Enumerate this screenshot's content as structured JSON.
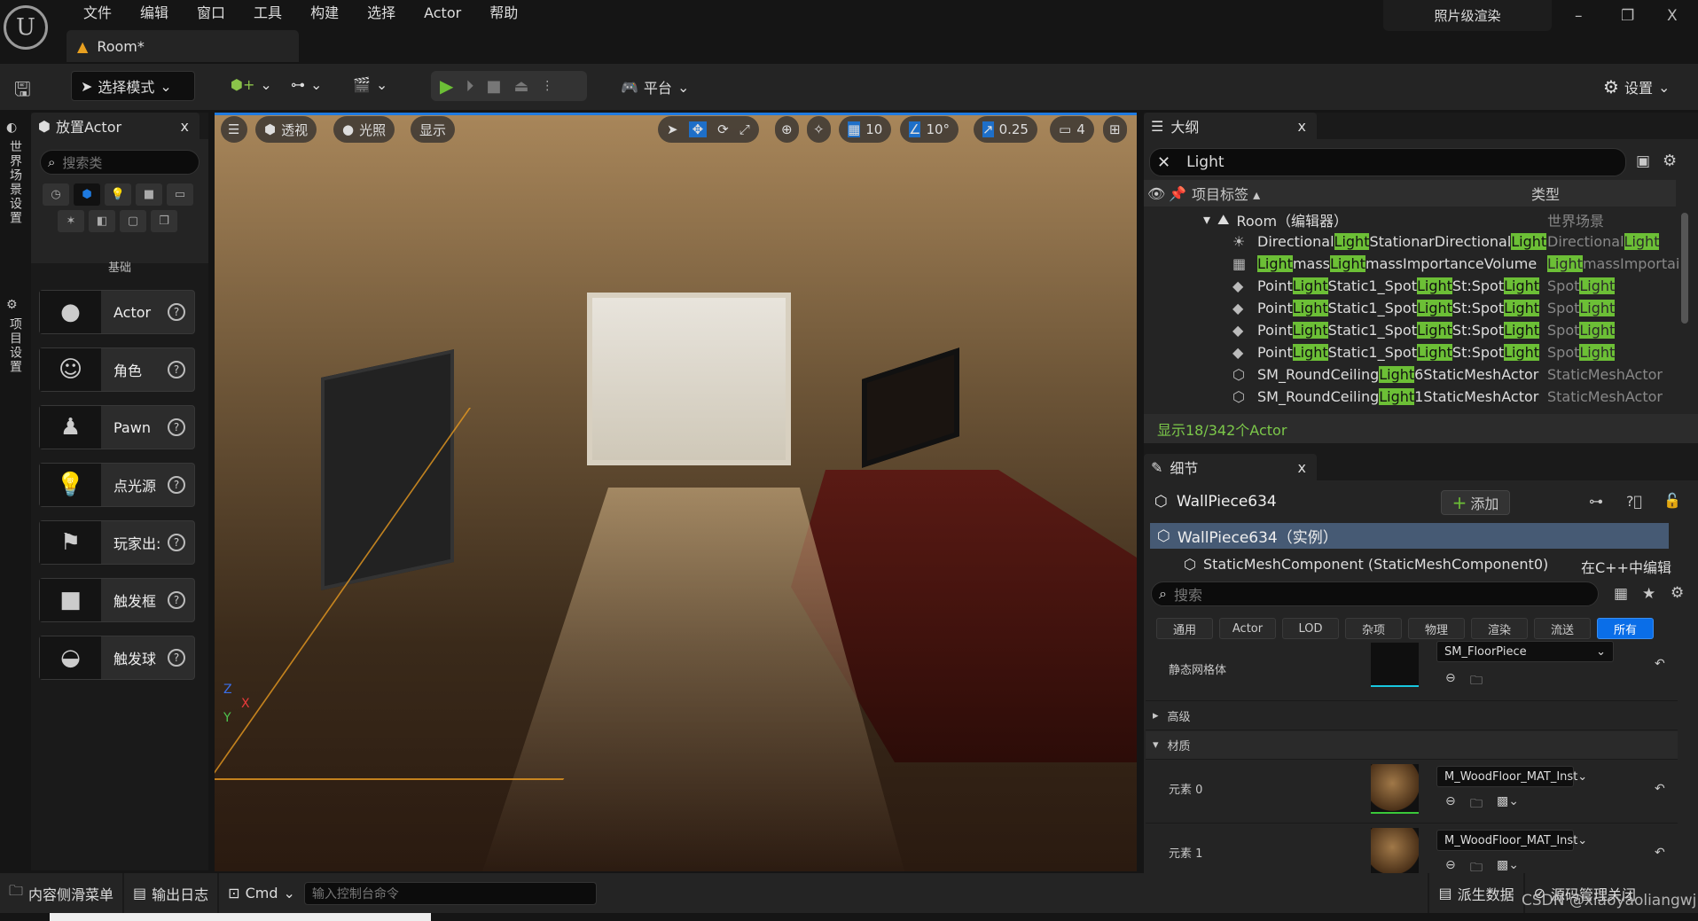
{
  "app": {
    "logo": "U",
    "menu": [
      "文件",
      "编辑",
      "窗口",
      "工具",
      "构建",
      "选择",
      "Actor",
      "帮助"
    ],
    "doc_tab": "Room*",
    "render_mode": "照片级渲染",
    "win": {
      "minimize": "–",
      "restore": "❐",
      "close": "X"
    }
  },
  "toolbar": {
    "mode": "选择模式",
    "platform": "平台",
    "settings": "设置"
  },
  "left_strip": {
    "world_settings": "世界场景设置",
    "project_settings": "项目设置"
  },
  "place_actors": {
    "title": "放置Actor",
    "close": "x",
    "search_placeholder": "搜索类",
    "category": "基础",
    "items": [
      {
        "label": "Actor",
        "icon": "●"
      },
      {
        "label": "角色",
        "icon": "☺"
      },
      {
        "label": "Pawn",
        "icon": "♟"
      },
      {
        "label": "点光源",
        "icon": "💡"
      },
      {
        "label": "玩家出:",
        "icon": "⚑"
      },
      {
        "label": "触发框",
        "icon": "■"
      },
      {
        "label": "触发球",
        "icon": "◒"
      }
    ]
  },
  "viewport": {
    "perspective": "透视",
    "lighting": "光照",
    "show": "显示",
    "grid": "10",
    "angle": "10°",
    "scale": "0.25",
    "camera_speed": "4",
    "axis_x": "X",
    "axis_y": "Y",
    "axis_z": "Z"
  },
  "outliner": {
    "title": "大纲",
    "close": "x",
    "search": "Light",
    "col_label": "项目标签",
    "col_type": "类型",
    "root": "Room（编辑器）",
    "root_type": "世界场景",
    "rows": [
      {
        "icon": "☀",
        "name": [
          [
            "Directional",
            0
          ],
          [
            "Light",
            1
          ],
          [
            "StationarDirectional",
            0
          ],
          [
            "Light",
            1
          ]
        ],
        "type": [
          [
            "Directional",
            0
          ],
          [
            "Light",
            1
          ]
        ]
      },
      {
        "icon": "▦",
        "name": [
          [
            "Light",
            1
          ],
          [
            "mass",
            0
          ],
          [
            "Light",
            1
          ],
          [
            "massImportanceVolume",
            0
          ]
        ],
        "type": [
          [
            "Light",
            1
          ],
          [
            "massImportai",
            0
          ]
        ]
      },
      {
        "icon": "◆",
        "name": [
          [
            "Point",
            0
          ],
          [
            "Light",
            1
          ],
          [
            "Static1_Spot",
            0
          ],
          [
            "Light",
            1
          ],
          [
            "St:Spot",
            0
          ],
          [
            "Light",
            1
          ]
        ],
        "type": [
          [
            "Spot",
            0
          ],
          [
            "Light",
            1
          ]
        ]
      },
      {
        "icon": "◆",
        "name": [
          [
            "Point",
            0
          ],
          [
            "Light",
            1
          ],
          [
            "Static1_Spot",
            0
          ],
          [
            "Light",
            1
          ],
          [
            "St:Spot",
            0
          ],
          [
            "Light",
            1
          ]
        ],
        "type": [
          [
            "Spot",
            0
          ],
          [
            "Light",
            1
          ]
        ]
      },
      {
        "icon": "◆",
        "name": [
          [
            "Point",
            0
          ],
          [
            "Light",
            1
          ],
          [
            "Static1_Spot",
            0
          ],
          [
            "Light",
            1
          ],
          [
            "St:Spot",
            0
          ],
          [
            "Light",
            1
          ]
        ],
        "type": [
          [
            "Spot",
            0
          ],
          [
            "Light",
            1
          ]
        ]
      },
      {
        "icon": "◆",
        "name": [
          [
            "Point",
            0
          ],
          [
            "Light",
            1
          ],
          [
            "Static1_Spot",
            0
          ],
          [
            "Light",
            1
          ],
          [
            "St:Spot",
            0
          ],
          [
            "Light",
            1
          ]
        ],
        "type": [
          [
            "Spot",
            0
          ],
          [
            "Light",
            1
          ]
        ]
      },
      {
        "icon": "⬡",
        "name": [
          [
            "SM_RoundCeiling",
            0
          ],
          [
            "Light",
            1
          ],
          [
            "6StaticMeshActor",
            0
          ]
        ],
        "type": [
          [
            "StaticMeshActor",
            0
          ]
        ]
      },
      {
        "icon": "⬡",
        "name": [
          [
            "SM_RoundCeiling",
            0
          ],
          [
            "Light",
            1
          ],
          [
            "1StaticMeshActor",
            0
          ]
        ],
        "type": [
          [
            "StaticMeshActor",
            0
          ]
        ]
      }
    ],
    "footer": "显示18/342个Actor"
  },
  "details": {
    "title": "细节",
    "close": "x",
    "actor": "WallPiece634",
    "add": "添加",
    "instance": "WallPiece634（实例）",
    "component": "StaticMeshComponent (StaticMeshComponent0)",
    "edit_cpp": "在C++中编辑",
    "search_placeholder": "搜索",
    "filters": [
      "通用",
      "Actor",
      "LOD",
      "杂项",
      "物理",
      "渲染",
      "流送",
      "所有"
    ],
    "static_mesh_label": "静态网格体",
    "static_mesh": "SM_FloorPiece",
    "advanced": "高级",
    "materials": "材质",
    "elements": [
      {
        "label": "元素 0",
        "value": "M_WoodFloor_MAT_Inst"
      },
      {
        "label": "元素 1",
        "value": "M_WoodFloor_MAT_Inst"
      }
    ]
  },
  "status": {
    "content_drawer": "内容侧滑菜单",
    "output_log": "输出日志",
    "cmd": "Cmd",
    "console_placeholder": "输入控制台命令",
    "derived_data": "派生数据",
    "source_control": "源码管理关闭",
    "watermark": "CSDN @xiaoyaoliangwj"
  },
  "colors": {
    "accent": "#1e7ae0",
    "highlight": "#6cbf36",
    "selection": "#465a74"
  }
}
